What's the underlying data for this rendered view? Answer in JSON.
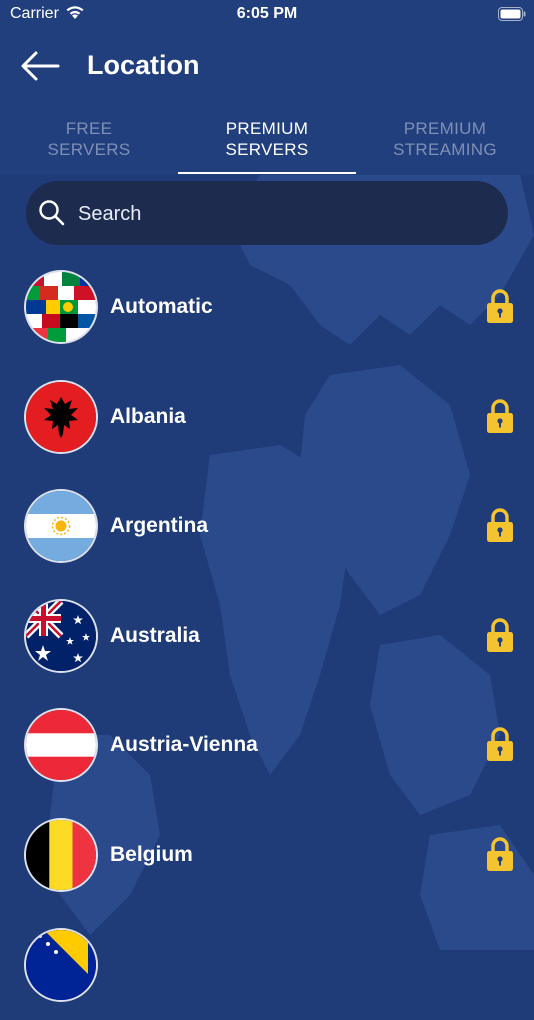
{
  "status": {
    "carrier": "Carrier",
    "time": "6:05 PM"
  },
  "header": {
    "title": "Location"
  },
  "tabs": [
    {
      "line1": "FREE",
      "line2": "SERVERS"
    },
    {
      "line1": "PREMIUM",
      "line2": "SERVERS"
    },
    {
      "line1": "PREMIUM",
      "line2": "STREAMING"
    }
  ],
  "active_tab": 1,
  "search": {
    "placeholder": "Search"
  },
  "servers": [
    {
      "name": "Automatic",
      "flag": "globe-flags",
      "locked": true
    },
    {
      "name": "Albania",
      "flag": "albania",
      "locked": true
    },
    {
      "name": "Argentina",
      "flag": "argentina",
      "locked": true
    },
    {
      "name": "Australia",
      "flag": "australia",
      "locked": true
    },
    {
      "name": "Austria-Vienna",
      "flag": "austria",
      "locked": true
    },
    {
      "name": "Belgium",
      "flag": "belgium",
      "locked": true
    },
    {
      "name": "",
      "flag": "bosnia",
      "locked": true
    }
  ],
  "colors": {
    "background": "#1f3b78",
    "header": "#223f7d",
    "search_bg": "#1c2b4e",
    "lock": "#f4c330",
    "inactive_tab": "#7f8fb5"
  }
}
